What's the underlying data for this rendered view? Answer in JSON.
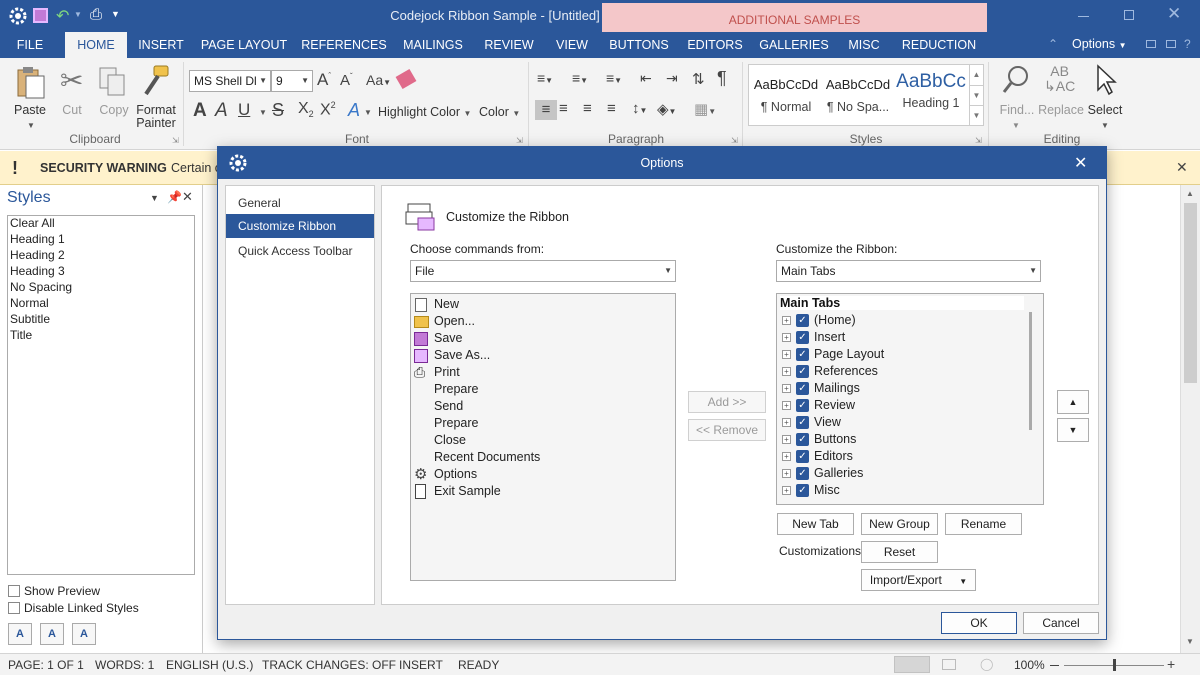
{
  "app": {
    "title": "Codejock Ribbon Sample - [Untitled]",
    "additional_samples": "ADDITIONAL SAMPLES",
    "options_label": "Options"
  },
  "tabs": [
    {
      "label": "FILE",
      "active": false
    },
    {
      "label": "HOME",
      "active": true
    },
    {
      "label": "INSERT",
      "active": false
    },
    {
      "label": "PAGE LAYOUT",
      "active": false
    },
    {
      "label": "REFERENCES",
      "active": false
    },
    {
      "label": "MAILINGS",
      "active": false
    },
    {
      "label": "REVIEW",
      "active": false
    },
    {
      "label": "VIEW",
      "active": false
    },
    {
      "label": "BUTTONS",
      "active": false
    },
    {
      "label": "EDITORS",
      "active": false
    },
    {
      "label": "GALLERIES",
      "active": false
    },
    {
      "label": "MISC",
      "active": false
    },
    {
      "label": "REDUCTION",
      "active": false
    }
  ],
  "ribbon": {
    "clipboard": {
      "paste": "Paste",
      "cut": "Cut",
      "copy": "Copy",
      "format1": "Format",
      "format2": "Painter",
      "label": "Clipboard"
    },
    "font": {
      "name": "MS Shell Dl",
      "size": "9",
      "highlight": "Highlight Color",
      "color": "Color",
      "label": "Font"
    },
    "paragraph": {
      "label": "Paragraph"
    },
    "styles": {
      "label": "Styles",
      "items": [
        {
          "preview": "AaBbCcDd",
          "name": "¶ Normal"
        },
        {
          "preview": "AaBbCcDd",
          "name": "¶ No Spa..."
        },
        {
          "preview": "AaBbCc",
          "name": "Heading 1"
        }
      ]
    },
    "editing": {
      "find": "Find...",
      "replace": "Replace",
      "select": "Select",
      "label": "Editing"
    }
  },
  "security": {
    "title": "SECURITY WARNING",
    "text": "Certain c"
  },
  "styles_pane": {
    "title": "Styles",
    "items": [
      "Clear All",
      "Heading 1",
      "Heading 2",
      "Heading 3",
      "No Spacing",
      "Normal",
      "Subtitle",
      "Title"
    ],
    "show_preview": "Show Preview",
    "disable_linked": "Disable Linked Styles"
  },
  "dialog": {
    "title": "Options",
    "nav": [
      {
        "label": "General",
        "selected": false
      },
      {
        "label": "Customize Ribbon",
        "selected": true
      },
      {
        "label": "Quick Access Toolbar",
        "selected": false
      }
    ],
    "heading": "Customize the Ribbon",
    "choose_label": "Choose commands from:",
    "choose_value": "File",
    "customize_label": "Customize the Ribbon:",
    "customize_value": "Main Tabs",
    "commands": [
      "New",
      "Open...",
      "Save",
      "Save As...",
      "Print",
      "Prepare",
      "Send",
      "Prepare",
      "Close",
      "Recent Documents",
      "Options",
      "Exit Sample"
    ],
    "add_button": "Add >>",
    "remove_button": "<< Remove",
    "tree_header": "Main Tabs",
    "tree_items": [
      "(Home)",
      "Insert",
      "Page Layout",
      "References",
      "Mailings",
      "Review",
      "View",
      "Buttons",
      "Editors",
      "Galleries",
      "Misc"
    ],
    "new_tab": "New Tab",
    "new_group": "New Group",
    "rename": "Rename",
    "customizations_label": "Customizations:",
    "reset": "Reset",
    "import_export": "Import/Export",
    "ok": "OK",
    "cancel": "Cancel"
  },
  "status": {
    "page": "PAGE: 1 OF 1",
    "words": "WORDS: 1",
    "language": "ENGLISH (U.S.)",
    "track": "TRACK CHANGES: OFF",
    "insert": "INSERT",
    "ready": "READY",
    "zoom": "100%"
  }
}
